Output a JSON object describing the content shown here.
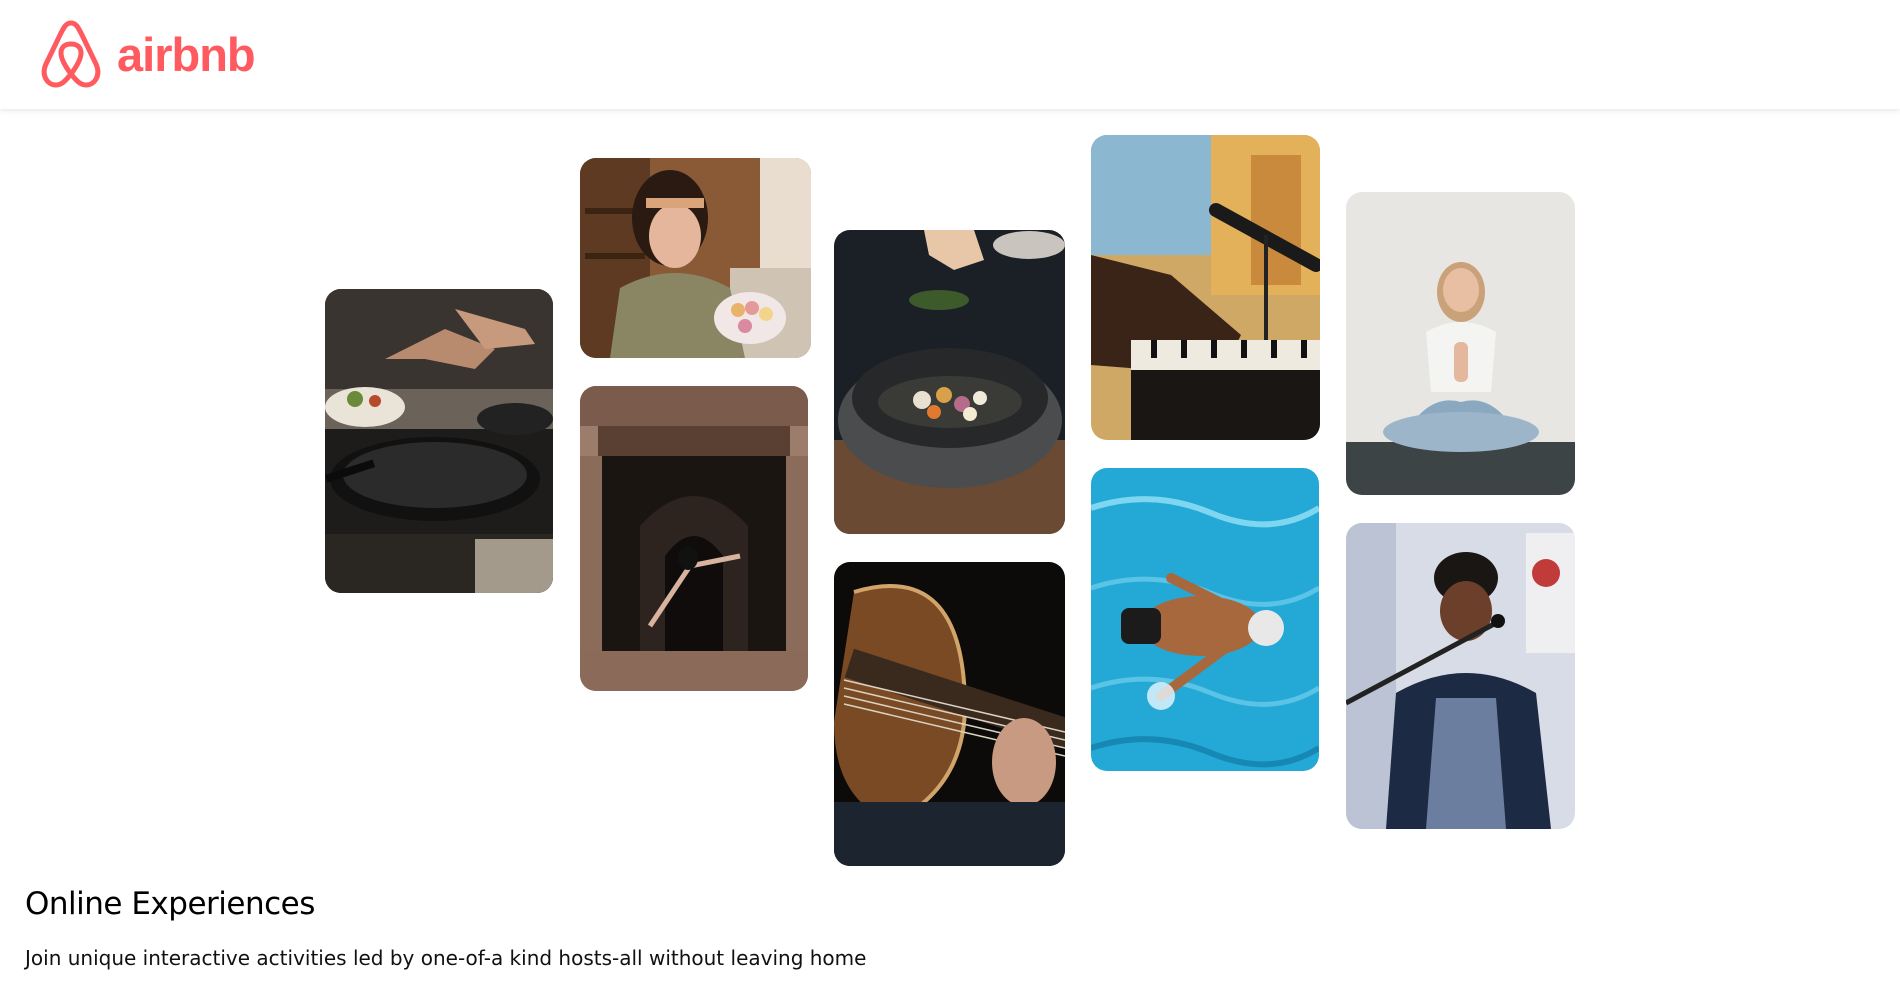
{
  "header": {
    "brand": "airbnb",
    "brand_color": "#FF5A5F",
    "logo_icon": "airbnb-belo-icon"
  },
  "gallery": [
    {
      "name": "cooking-hands-pan-photo",
      "subject": "cooking"
    },
    {
      "name": "woman-macarons-photo",
      "subject": "baking"
    },
    {
      "name": "dancer-archway-photo",
      "subject": "dance"
    },
    {
      "name": "salting-bowl-photo",
      "subject": "cooking"
    },
    {
      "name": "guitar-playing-photo",
      "subject": "guitar"
    },
    {
      "name": "piano-microphone-photo",
      "subject": "music"
    },
    {
      "name": "swimmer-pool-photo",
      "subject": "swimming"
    },
    {
      "name": "yoga-meditation-photo",
      "subject": "yoga"
    },
    {
      "name": "singer-microphone-photo",
      "subject": "singing"
    }
  ],
  "section": {
    "title": "Online Experiences",
    "subtitle": "Join unique interactive activities led by one-of-a kind hosts-all without leaving home"
  }
}
